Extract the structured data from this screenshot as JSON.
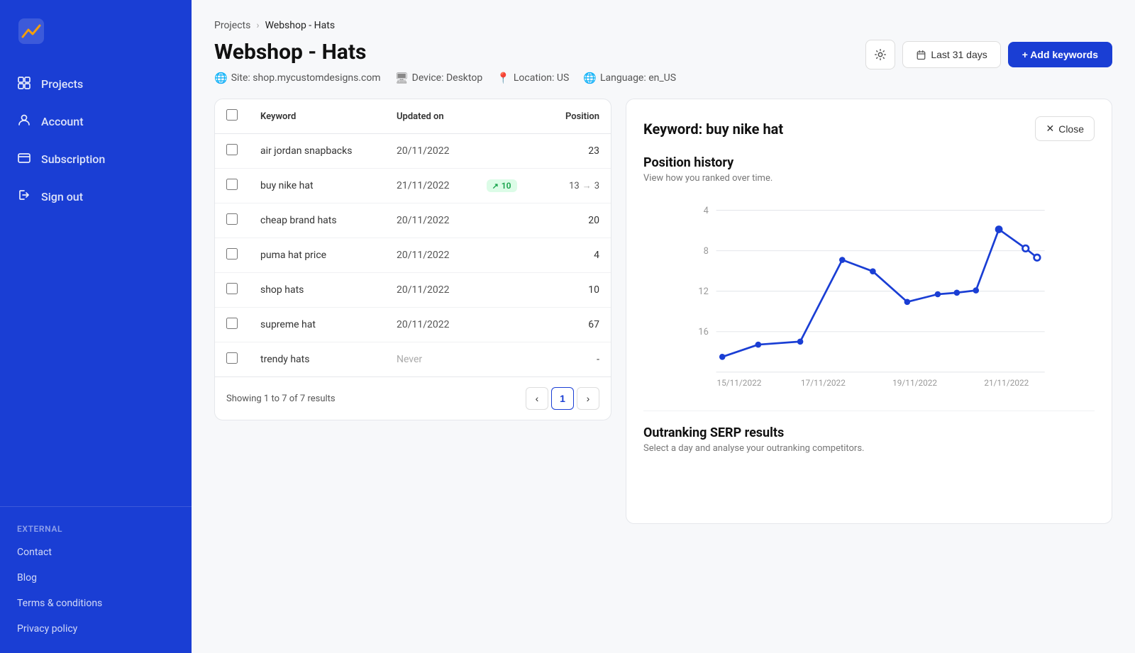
{
  "sidebar": {
    "logo_alt": "Analytics Logo",
    "nav_items": [
      {
        "id": "projects",
        "label": "Projects",
        "icon": "🗂"
      },
      {
        "id": "account",
        "label": "Account",
        "icon": "⚙"
      },
      {
        "id": "subscription",
        "label": "Subscription",
        "icon": "💳"
      },
      {
        "id": "signout",
        "label": "Sign out",
        "icon": "↩"
      }
    ],
    "external_label": "External",
    "bottom_links": [
      "Contact",
      "Blog",
      "Terms & conditions",
      "Privacy policy"
    ]
  },
  "breadcrumb": {
    "parent": "Projects",
    "current": "Webshop - Hats"
  },
  "page": {
    "title": "Webshop - Hats",
    "site": "Site: shop.mycustomdesigns.com",
    "device": "Device: Desktop",
    "location": "Location: US",
    "language": "Language: en_US",
    "date_range": "Last 31 days",
    "add_keywords": "+ Add keywords"
  },
  "table": {
    "headers": [
      "",
      "Keyword",
      "Updated on",
      "",
      "Position"
    ],
    "showing": "Showing 1 to 7 of 7 results",
    "page": "1",
    "rows": [
      {
        "keyword": "air jordan snapbacks",
        "updated": "20/11/2022",
        "badge": null,
        "pos_from": null,
        "pos_to": null,
        "position": "23"
      },
      {
        "keyword": "buy nike hat",
        "updated": "21/11/2022",
        "badge": "10",
        "pos_from": "13",
        "pos_to": "3",
        "position": null
      },
      {
        "keyword": "cheap brand hats",
        "updated": "20/11/2022",
        "badge": null,
        "pos_from": null,
        "pos_to": null,
        "position": "20"
      },
      {
        "keyword": "puma hat price",
        "updated": "20/11/2022",
        "badge": null,
        "pos_from": null,
        "pos_to": null,
        "position": "4"
      },
      {
        "keyword": "shop hats",
        "updated": "20/11/2022",
        "badge": null,
        "pos_from": null,
        "pos_to": null,
        "position": "10"
      },
      {
        "keyword": "supreme hat",
        "updated": "20/11/2022",
        "badge": null,
        "pos_from": null,
        "pos_to": null,
        "position": "67"
      },
      {
        "keyword": "trendy hats",
        "updated": "Never",
        "badge": null,
        "pos_from": null,
        "pos_to": null,
        "position": "-"
      }
    ]
  },
  "detail": {
    "keyword_label": "Keyword: buy nike hat",
    "close_label": "Close",
    "position_history_title": "Position history",
    "position_history_sub": "View how you ranked over time.",
    "outranking_title": "Outranking SERP results",
    "outranking_sub": "Select a day and analyse your outranking competitors.",
    "chart_x_labels": [
      "15/11/2022",
      "17/11/2022",
      "19/11/2022",
      "21/11/2022"
    ],
    "chart_y_labels": [
      "4",
      "8",
      "12",
      "16"
    ],
    "chart_points": [
      {
        "x": 0.02,
        "y": 0.87
      },
      {
        "x": 0.16,
        "y": 0.78
      },
      {
        "x": 0.26,
        "y": 0.76
      },
      {
        "x": 0.38,
        "y": 0.35
      },
      {
        "x": 0.45,
        "y": 0.42
      },
      {
        "x": 0.54,
        "y": 0.58
      },
      {
        "x": 0.64,
        "y": 0.55
      },
      {
        "x": 0.72,
        "y": 0.53
      },
      {
        "x": 0.79,
        "y": 0.52
      },
      {
        "x": 0.86,
        "y": 0.18
      },
      {
        "x": 0.94,
        "y": 0.28
      },
      {
        "x": 0.98,
        "y": 0.32
      }
    ]
  }
}
